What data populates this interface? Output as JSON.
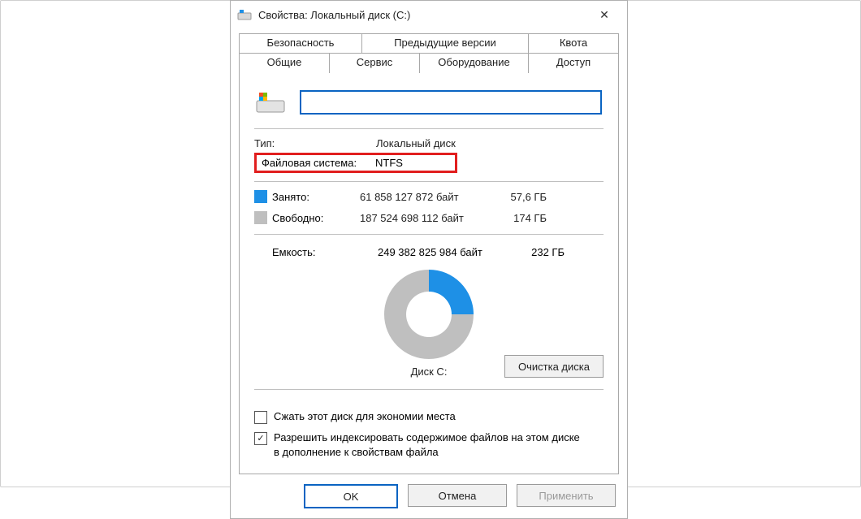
{
  "window": {
    "title": "Свойства: Локальный диск (C:)",
    "close_glyph": "✕"
  },
  "tabs": {
    "row1": [
      {
        "label": "Безопасность"
      },
      {
        "label": "Предыдущие версии"
      },
      {
        "label": "Квота"
      }
    ],
    "row2": [
      {
        "label": "Общие",
        "active": true
      },
      {
        "label": "Сервис"
      },
      {
        "label": "Оборудование"
      },
      {
        "label": "Доступ"
      }
    ]
  },
  "general": {
    "drive_name_value": "",
    "type_label": "Тип:",
    "type_value": "Локальный диск",
    "fs_label": "Файловая система:",
    "fs_value": "NTFS",
    "used_label": "Занято:",
    "used_bytes": "61 858 127 872 байт",
    "used_gb": "57,6 ГБ",
    "free_label": "Свободно:",
    "free_bytes": "187 524 698 112 байт",
    "free_gb": "174 ГБ",
    "capacity_label": "Емкость:",
    "capacity_bytes": "249 382 825 984 байт",
    "capacity_gb": "232 ГБ",
    "disk_caption": "Диск C:",
    "cleanup_label": "Очистка диска",
    "compress_label": "Сжать этот диск для экономии места",
    "compress_checked": false,
    "index_label": "Разрешить индексировать содержимое файлов на этом диске в дополнение к свойствам файла",
    "index_checked": true
  },
  "buttons": {
    "ok": "OK",
    "cancel": "Отмена",
    "apply": "Применить"
  },
  "colors": {
    "used": "#1e90e6",
    "free": "#bfbfbf",
    "accent": "#0a64c2",
    "highlight_box": "#e11e1e"
  },
  "chart_data": {
    "type": "pie",
    "title": "Диск C:",
    "series": [
      {
        "name": "Занято",
        "value": 61858127872,
        "value_label": "57,6 ГБ",
        "color": "#1e90e6"
      },
      {
        "name": "Свободно",
        "value": 187524698112,
        "value_label": "174 ГБ",
        "color": "#bfbfbf"
      }
    ],
    "total": {
      "name": "Емкость",
      "value": 249382825984,
      "value_label": "232 ГБ"
    }
  }
}
